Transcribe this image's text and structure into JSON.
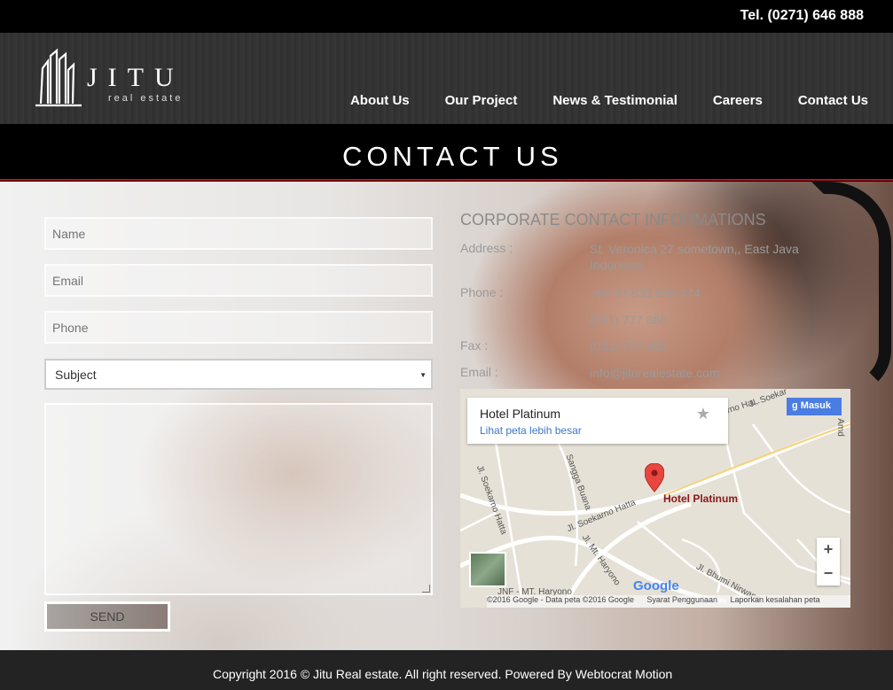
{
  "topbar": {
    "tel": "Tel. (0271) 646 888"
  },
  "logo": {
    "brand": "JITU",
    "sub": "real estate"
  },
  "nav": [
    {
      "label": "About Us"
    },
    {
      "label": "Our Project"
    },
    {
      "label": "News & Testimonial"
    },
    {
      "label": "Careers"
    },
    {
      "label": "Contact Us"
    }
  ],
  "page_title": "CONTACT US",
  "form": {
    "name_placeholder": "Name",
    "email_placeholder": "Email",
    "phone_placeholder": "Phone",
    "subject_value": "Subject",
    "send_label": "SEND"
  },
  "contact": {
    "heading": "CORPORATE CONTACT INFORMATIONS",
    "address_label": "Address :",
    "address_value": "St. Veronica 27 sometown,, East Java Indonesia",
    "phone_label": "Phone :",
    "phone_value_1": "+62 87 833 555 444",
    "phone_value_2": "(031) 777 888",
    "fax_label": "Fax :",
    "fax_value": "(031) 777 889",
    "email_label": "Email :",
    "email_value": "info@jiturealestate.com"
  },
  "map": {
    "place_title": "Hotel Platinum",
    "larger_map_link": "Lihat peta lebih besar",
    "signin_label": "Masuk",
    "marker_label": "Hotel Platinum",
    "zoom_in": "+",
    "zoom_out": "−",
    "google_logo": "Google",
    "attribution": "©2016 Google - Data peta ©2016 Google",
    "terms": "Syarat Penggunaan",
    "report": "Laporkan kesalahan peta",
    "roads": {
      "r1": "Jl. Soekarno Hatta",
      "r2": "Jl. Soekarno Hatta",
      "r3": "Jl. Soekarno Ha...",
      "r4": "Sangga Buana",
      "r5": "Jl. Mt. Haryono",
      "r6": "Jl. Bhumi Nirwana",
      "r7": "JNF - MT. Haryono",
      "r8": "Amd",
      "r9": "Jl. Soekar"
    }
  },
  "footer": {
    "copyright": "Copyright 2016 © Jitu Real estate. All right reserved. Powered By Webtocrat Motion"
  },
  "colors": {
    "accent_red": "#b3151a",
    "link_blue": "#3a78c9",
    "signin_blue": "#4a7de2"
  }
}
